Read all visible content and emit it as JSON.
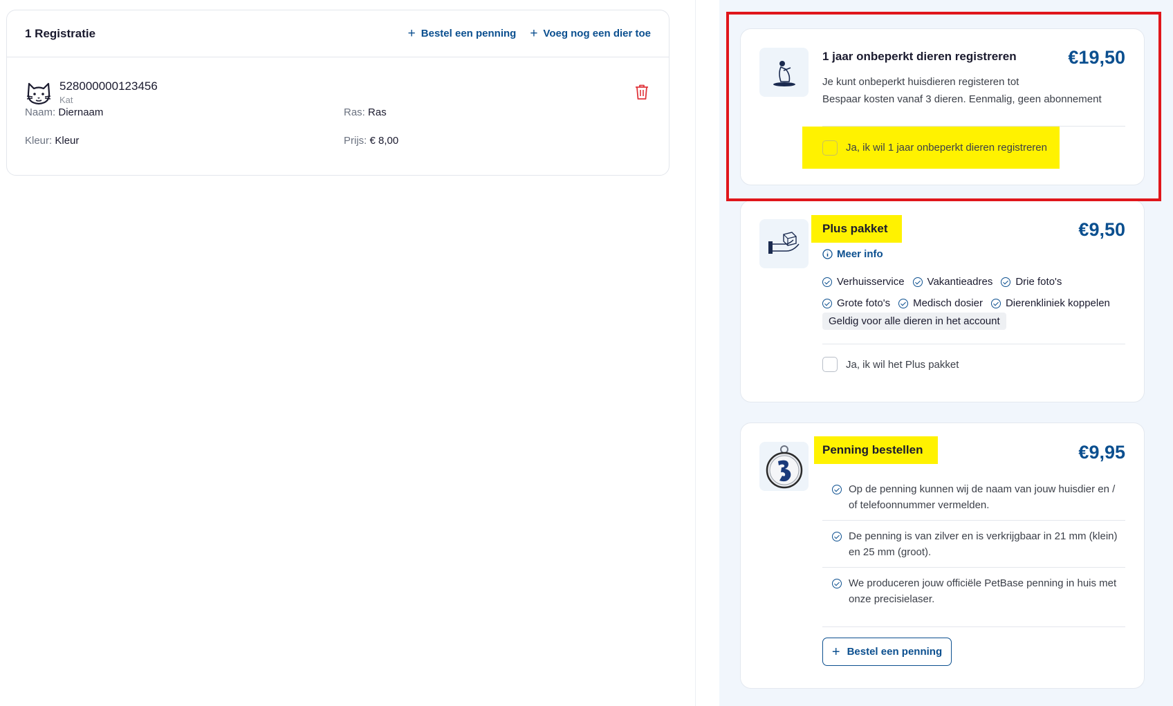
{
  "registration": {
    "title": "1 Registratie",
    "order_tag": "Bestel een penning",
    "add_animal": "Voeg nog een dier toe",
    "animal": {
      "chip": "528000000123456",
      "species": "Kat",
      "name_label": "Naam:",
      "name_value": "Diernaam",
      "breed_label": "Ras:",
      "breed_value": "Ras",
      "color_label": "Kleur:",
      "color_value": "Kleur",
      "price_label": "Prijs:",
      "price_value": "€ 8,00"
    }
  },
  "offers": {
    "unlimited": {
      "title": "1 jaar onbeperkt dieren registreren",
      "price": "€19,50",
      "desc1": "Je kunt onbeperkt huisdieren registeren tot",
      "desc2": "Bespaar kosten vanaf 3 dieren. Eenmalig, geen abonnement",
      "checkbox": "Ja, ik wil 1 jaar onbeperkt dieren registreren",
      "checked": false
    },
    "plus": {
      "title": "Plus pakket",
      "price": "€9,50",
      "more_info": "Meer info",
      "features_row1": [
        "Verhuisservice",
        "Vakantieadres",
        "Drie foto's"
      ],
      "features_row2": [
        "Grote foto's",
        "Medisch dosier",
        "Dierenkliniek koppelen"
      ],
      "badge": "Geldig voor alle dieren in het account",
      "checkbox": "Ja, ik wil het Plus pakket",
      "checked": false
    },
    "tag": {
      "title": "Penning bestellen",
      "price": "€9,95",
      "bullets": [
        "Op de penning kunnen wij de naam van jouw huisdier en / of telefoonnummer vermelden.",
        "De penning is van zilver en is verkrijgbaar in 21 mm (klein) en 25 mm (groot).",
        "We produceren jouw officiële PetBase penning in huis met onze precisielaser."
      ],
      "button": "Bestel een penning"
    }
  },
  "colors": {
    "brand": "#0b4f8f",
    "highlight": "#fff200",
    "annotation": "#e0161b",
    "delete": "#e0353b"
  },
  "icons": [
    "plus-icon",
    "cat-icon",
    "trash-icon",
    "yoga-person-icon",
    "hand-box-icon",
    "info-icon",
    "check-circle-icon",
    "pet-tag-icon"
  ]
}
